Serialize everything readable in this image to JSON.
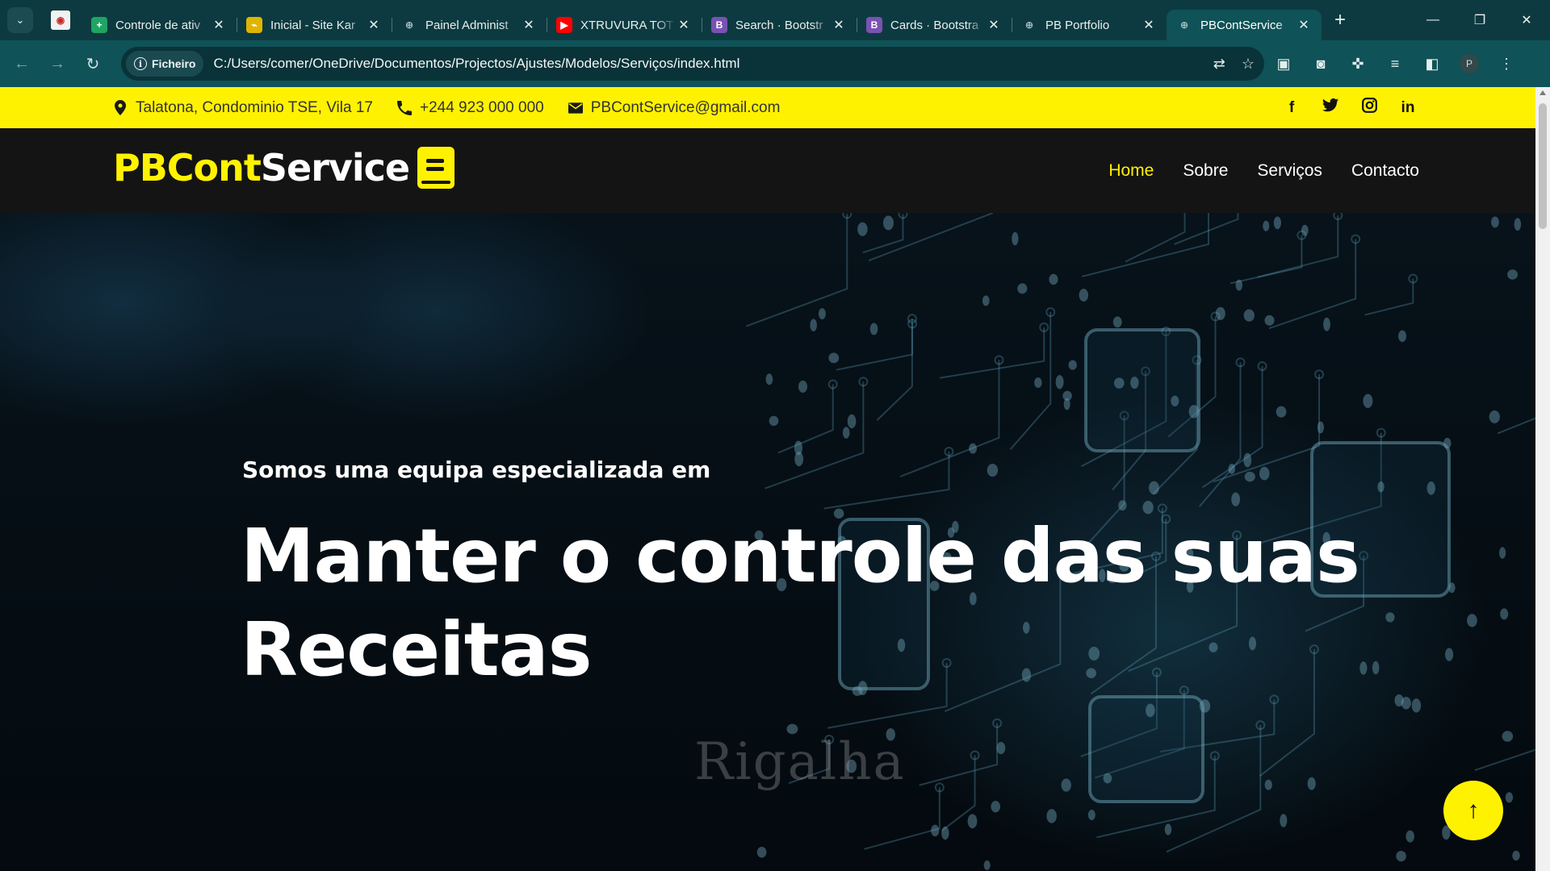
{
  "browser": {
    "tabs": [
      {
        "title": "Controle de ativ",
        "favicon": "sheets-icon",
        "fav_color": "#1fa463",
        "fav_glyph": "+"
      },
      {
        "title": "Inicial - Site Kar",
        "favicon": "site-icon",
        "fav_color": "#e0b400",
        "fav_glyph": "⌁"
      },
      {
        "title": "Painel Administ",
        "favicon": "globe-icon",
        "fav_color": "#9bb7b9",
        "fav_glyph": "⊕"
      },
      {
        "title": "XTRUVURA TOT",
        "favicon": "youtube-icon",
        "fav_color": "#ff0000",
        "fav_glyph": "▶"
      },
      {
        "title": "Search · Bootstr",
        "favicon": "bootstrap-icon",
        "fav_color": "#7952b3",
        "fav_glyph": "B"
      },
      {
        "title": "Cards · Bootstra",
        "favicon": "bootstrap-icon",
        "fav_color": "#7952b3",
        "fav_glyph": "B"
      },
      {
        "title": "PB Portfolio",
        "favicon": "globe-icon",
        "fav_color": "#9bb7b9",
        "fav_glyph": "⊕"
      },
      {
        "title": "PBContService",
        "favicon": "globe-icon",
        "fav_color": "#9bb7b9",
        "fav_glyph": "⊕",
        "active": true
      }
    ],
    "address": {
      "chip_label": "Ficheiro",
      "url": "C:/Users/comer/OneDrive/Documentos/Projectos/Ajustes/Modelos/Serviços/index.html"
    },
    "profile_initial": "P"
  },
  "topbar": {
    "address": "Talatona, Condominio TSE, Vila 17",
    "phone": "+244 923 000 000",
    "email": "PBContService@gmail.com",
    "social": [
      "f",
      "t",
      "ig",
      "in"
    ]
  },
  "navbar": {
    "brand_part1": "PBCont",
    "brand_part2": "Service",
    "menu": [
      "Home",
      "Sobre",
      "Serviços",
      "Contacto"
    ],
    "active_item": "Home"
  },
  "hero": {
    "subtitle": "Somos uma equipa especializada em",
    "title": "Manter o controle das suas Receitas"
  },
  "colors": {
    "accent": "#fff200",
    "navbar_bg": "#141414",
    "chrome_tabstrip": "#0d3a40",
    "chrome_toolbar": "#0f5257"
  }
}
